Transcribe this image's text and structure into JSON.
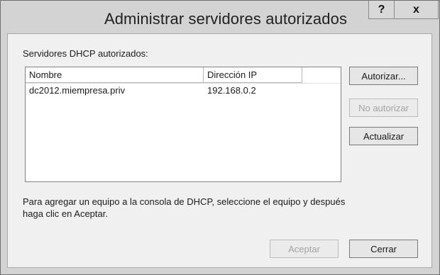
{
  "window": {
    "title": "Administrar servidores autorizados",
    "help_label": "?",
    "close_label": "x"
  },
  "list": {
    "caption": "Servidores DHCP autorizados:",
    "columns": [
      "Nombre",
      "Dirección IP",
      ""
    ],
    "rows": [
      {
        "name": "dc2012.miempresa.priv",
        "ip": "192.168.0.2"
      }
    ]
  },
  "buttons": {
    "autorizar": "Autorizar...",
    "no_autorizar": "No autorizar",
    "actualizar": "Actualizar",
    "aceptar": "Aceptar",
    "cerrar": "Cerrar"
  },
  "info": {
    "line1": "Para agregar un equipo a la consola de DHCP, seleccione el equipo y después",
    "line2": "haga clic en Aceptar."
  }
}
